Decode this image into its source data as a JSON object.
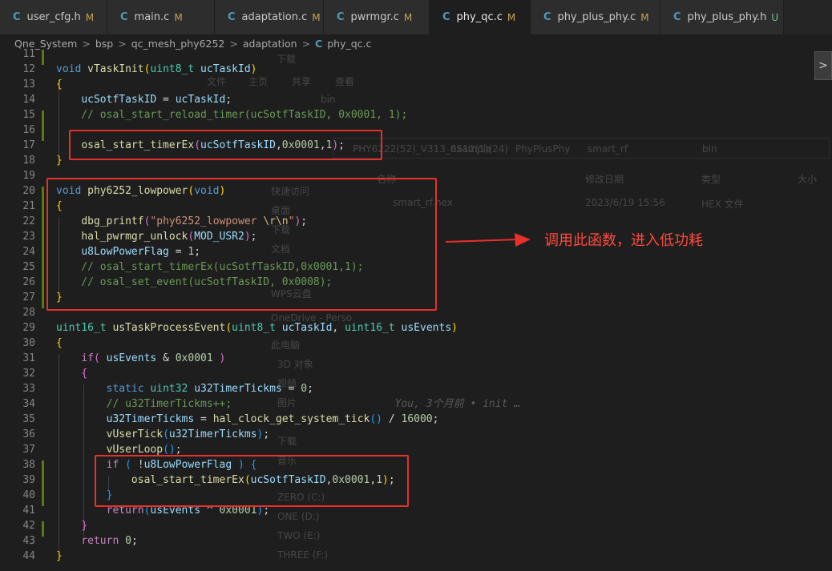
{
  "tabs": [
    {
      "icon": "C",
      "label": "user_cfg.h",
      "status": "M"
    },
    {
      "icon": "C",
      "label": "main.c",
      "status": "M"
    },
    {
      "icon": "C",
      "label": "adaptation.c",
      "status": "M"
    },
    {
      "icon": "C",
      "label": "pwrmgr.c",
      "status": "M"
    },
    {
      "icon": "C",
      "label": "phy_qc.c",
      "status": "M"
    },
    {
      "icon": "C",
      "label": "phy_plus_phy.c",
      "status": "M"
    },
    {
      "icon": "C",
      "label": "phy_plus_phy.h",
      "status": "U"
    }
  ],
  "breadcrumb": {
    "items": [
      "Qne_System",
      "bsp",
      "qc_mesh_phy6252",
      "adaptation"
    ],
    "file_icon": "C",
    "file": "phy_qc.c",
    "separator": ">"
  },
  "line_numbers": [
    "11",
    "12",
    "13",
    "14",
    "15",
    "16",
    "17",
    "18",
    "19",
    "20",
    "21",
    "22",
    "23",
    "24",
    "25",
    "26",
    "27",
    "28",
    "29",
    "30",
    "31",
    "32",
    "33",
    "34",
    "35",
    "36",
    "37",
    "38",
    "39",
    "40",
    "41",
    "42",
    "43",
    "44"
  ],
  "blame": "You, 3个月前 • init …",
  "annotation": "调用此函数，进入低功耗",
  "scroll_button": ">",
  "background_explorer": {
    "toolbar": [
      "文件",
      "主页",
      "共享",
      "查看"
    ],
    "address": [
      "PHY6222(52)_V313_0512(1)(24)",
      "example",
      "PhyPlusPhy",
      "smart_rf",
      "bin"
    ],
    "columns": [
      "名称",
      "修改日期",
      "类型",
      "大小"
    ],
    "file": {
      "name": "smart_rf.hex",
      "date": "2023/6/19 15:56",
      "type": "HEX 文件"
    },
    "nav": [
      "快速访问",
      "桌面",
      "下载",
      "文档",
      "WPS云盘",
      "OneDrive - Perso",
      "此电脑",
      "3D 对象",
      "视频",
      "图片",
      "下载",
      "音乐",
      "ZERO (C:)",
      "ONE (D:)",
      "TWO (E:)",
      "THREE (F:)"
    ],
    "bin_label": "bin",
    "down_label": "下载"
  },
  "colors": {
    "accent_red": "#e8302a",
    "c_icon": "#519aba",
    "modified": "#c5a25a",
    "untracked": "#73c991"
  }
}
